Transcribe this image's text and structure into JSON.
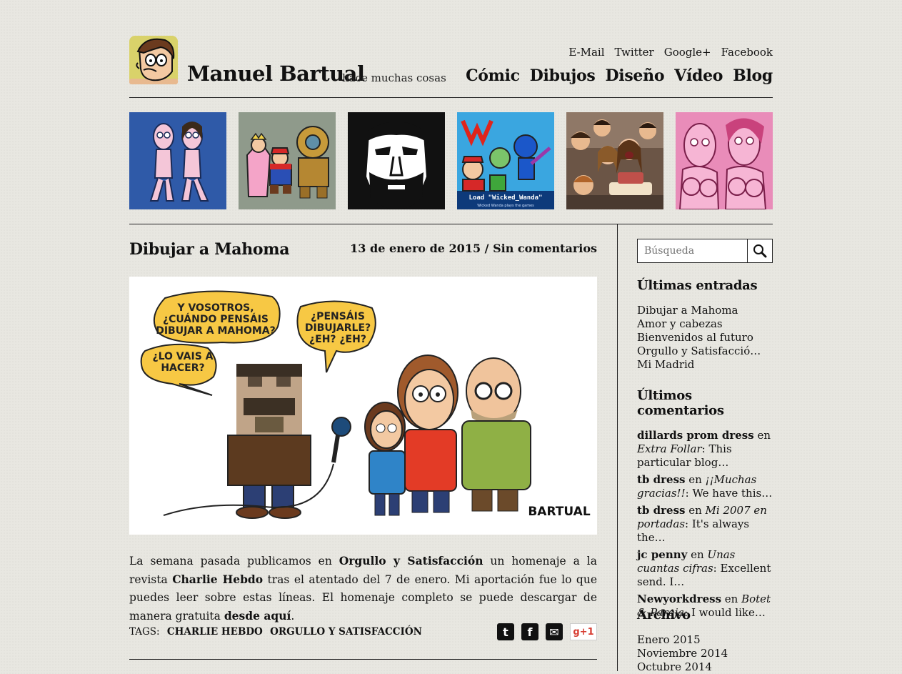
{
  "site": {
    "title": "Manuel Bartual",
    "tagline": "hace muchas cosas"
  },
  "social": [
    "E-Mail",
    "Twitter",
    "Google+",
    "Facebook"
  ],
  "nav": [
    "Cómic",
    "Dibujos",
    "Diseño",
    "Vídeo",
    "Blog"
  ],
  "thumbnails": [
    {
      "subject": "naked-couple-drawing"
    },
    {
      "subject": "videogame-characters"
    },
    {
      "subject": "bearded-face-portrait"
    },
    {
      "subject": "wicked-wanda-cover",
      "caption": "Load \"Wicked_Wanda\"",
      "subcaption": "Wicked Wanda plays the games"
    },
    {
      "subject": "birthday-party-photo"
    },
    {
      "subject": "pink-illustration"
    }
  ],
  "post": {
    "title": "Dibujar a Mahoma",
    "date": "13 de enero de 2015",
    "separator": " / ",
    "comments": "Sin comentarios",
    "comic": {
      "bubble1": "Y VOSOTROS, ¿CUÁNDO PENSÁIS DIBUJAR A MAHOMA?",
      "bubble2": "¿LO VAIS A HACER?",
      "bubble3": "¿PENSÁIS DIBUJARLE? ¿EH? ¿EH?",
      "signature": "BARTUAL"
    },
    "body": {
      "t1": "La semana pasada publicamos en ",
      "l1": "Orgullo y Satisfacción",
      "t2": " un homenaje a la revista ",
      "l2": "Charlie Hebdo",
      "t3": " tras el atentado del 7 de enero. Mi aportación fue lo que puedes leer sobre estas líneas. El homenaje completo se puede descargar de manera gratuita ",
      "l3": "desde aquí",
      "t4": "."
    },
    "tags_label": "TAGS:",
    "tags": [
      "CHARLIE HEBDO",
      "ORGULLO Y SATISFACCIÓN"
    ],
    "share": {
      "twitter": "t",
      "facebook": "f",
      "email": "✉",
      "gplus": "g+1"
    }
  },
  "sidebar": {
    "search_placeholder": "Búsqueda",
    "recent_title": "Últimas entradas",
    "recent": [
      "Dibujar a Mahoma",
      "Amor y cabezas",
      "Bienvenidos al futuro",
      "Orgullo y Satisfacció…",
      "Mi Madrid"
    ],
    "comments_title": "Últimos comentarios",
    "comments": [
      {
        "author": "dillards prom dress",
        "on": " en ",
        "post": "Extra Follar",
        "excerpt": ": This particular blog…"
      },
      {
        "author": "tb dress",
        "on": " en ",
        "post": "¡¡Muchas gracias!!",
        "excerpt": ": We have this…"
      },
      {
        "author": "tb dress",
        "on": " en ",
        "post": "Mi 2007 en portadas",
        "excerpt": ": It's always the…"
      },
      {
        "author": "jc penny",
        "on": " en ",
        "post": "Unas cuantas cifras",
        "excerpt": ": Excellent send. I…"
      },
      {
        "author": "Newyorkdress",
        "on": " en ",
        "post": "Botet & Pareja",
        "excerpt": ": I would like…"
      }
    ],
    "archive_title": "Archivo",
    "archive": [
      "Enero 2015",
      "Noviembre 2014",
      "Octubre 2014"
    ]
  },
  "colors": {
    "background": "#e8e7e1",
    "text": "#111111",
    "bubble": "#f7c844",
    "thumb_blue": "#2f5aa8",
    "thumb_pink": "#e98cb9"
  }
}
